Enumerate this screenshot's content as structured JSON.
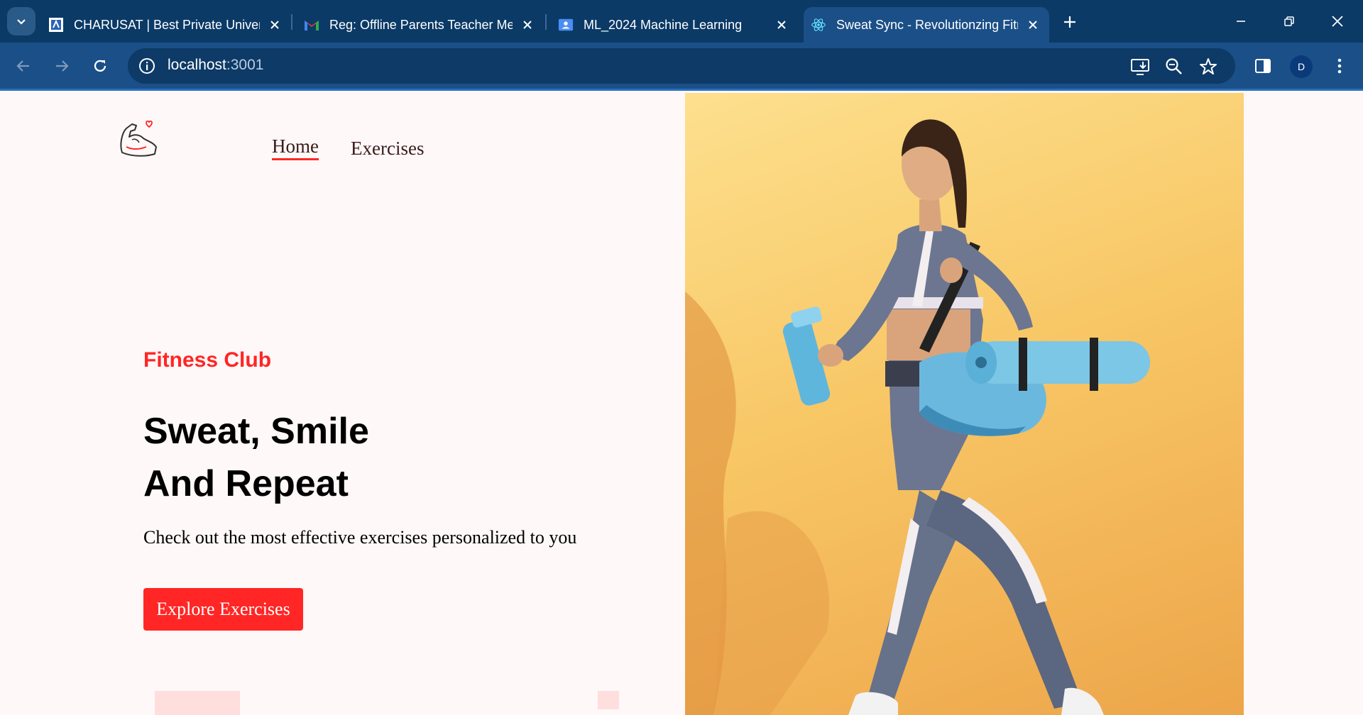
{
  "browser": {
    "tabs": [
      {
        "title": "CHARUSAT | Best Private Univer",
        "icon": "charusat-favicon-icon"
      },
      {
        "title": "Reg: Offline Parents Teacher Me",
        "icon": "gmail-icon"
      },
      {
        "title": "ML_2024 Machine Learning",
        "icon": "classroom-icon"
      },
      {
        "title": "Sweat Sync - Revolutionzing Fitr",
        "icon": "react-icon",
        "active": true
      }
    ],
    "url_host": "localhost",
    "url_port": ":3001",
    "profile_initial": "D",
    "colors": {
      "tabbar": "#0b3a66",
      "toolbar": "#1b4f87"
    }
  },
  "nav": {
    "home_label": "Home",
    "exercises_label": "Exercises"
  },
  "hero": {
    "kicker": "Fitness Club",
    "headline_line1": "Sweat, Smile",
    "headline_line2": "And Repeat",
    "subtext": "Check out the most effective exercises personalized to you",
    "cta_label": "Explore Exercises",
    "accent_color": "#ff2625"
  }
}
